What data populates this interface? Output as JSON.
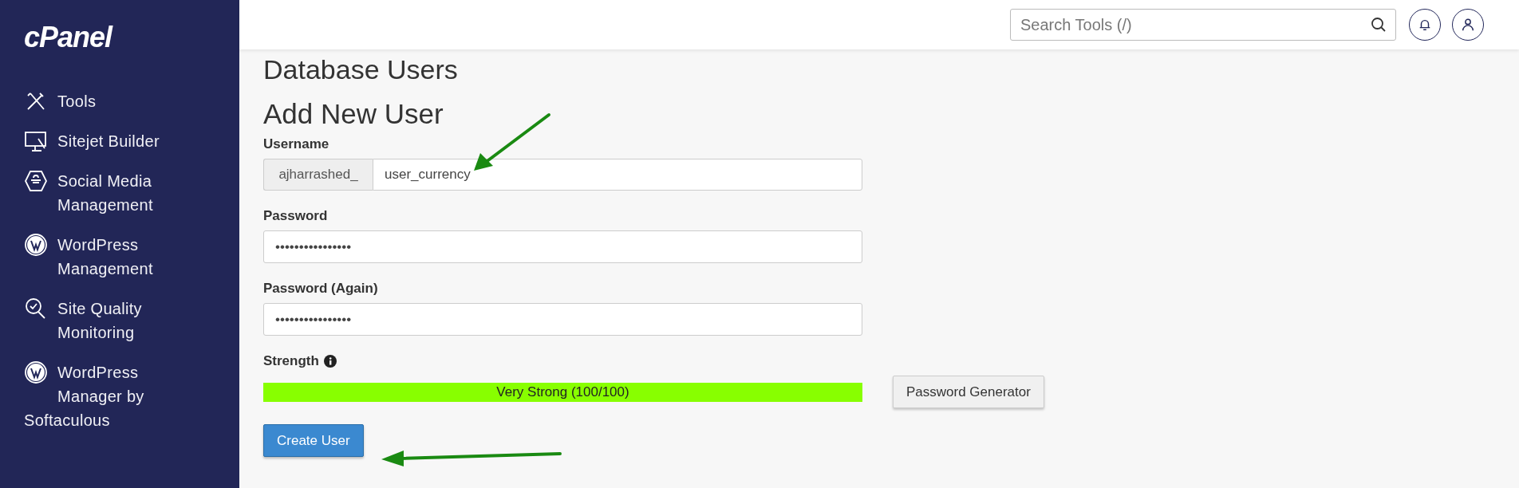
{
  "sidebar": {
    "logo": "cPanel",
    "items": [
      {
        "label": "Tools",
        "kind": "tools"
      },
      {
        "label": "Sitejet Builder",
        "kind": "monitor"
      },
      {
        "label": "Social Media Management",
        "kind": "hexagon"
      },
      {
        "label": "WordPress Management",
        "kind": "wordpress"
      },
      {
        "label": "Site Quality Monitoring",
        "kind": "magnifier"
      },
      {
        "label": "WordPress Manager by Softaculous",
        "kind": "wordpress"
      }
    ]
  },
  "header": {
    "search": {
      "placeholder": "Search Tools (/)"
    }
  },
  "page": {
    "title": "Database Users",
    "section": "Add New User",
    "username": {
      "label": "Username",
      "prefix": "ajharrashed_",
      "value": "user_currency"
    },
    "password": {
      "label": "Password",
      "value": "••••••••••••••••"
    },
    "password_again": {
      "label": "Password (Again)",
      "value": "••••••••••••••••"
    },
    "strength": {
      "label": "Strength",
      "text": "Very Strong (100/100)",
      "level": 1
    },
    "generator_button": "Password Generator",
    "submit_button": "Create User"
  }
}
